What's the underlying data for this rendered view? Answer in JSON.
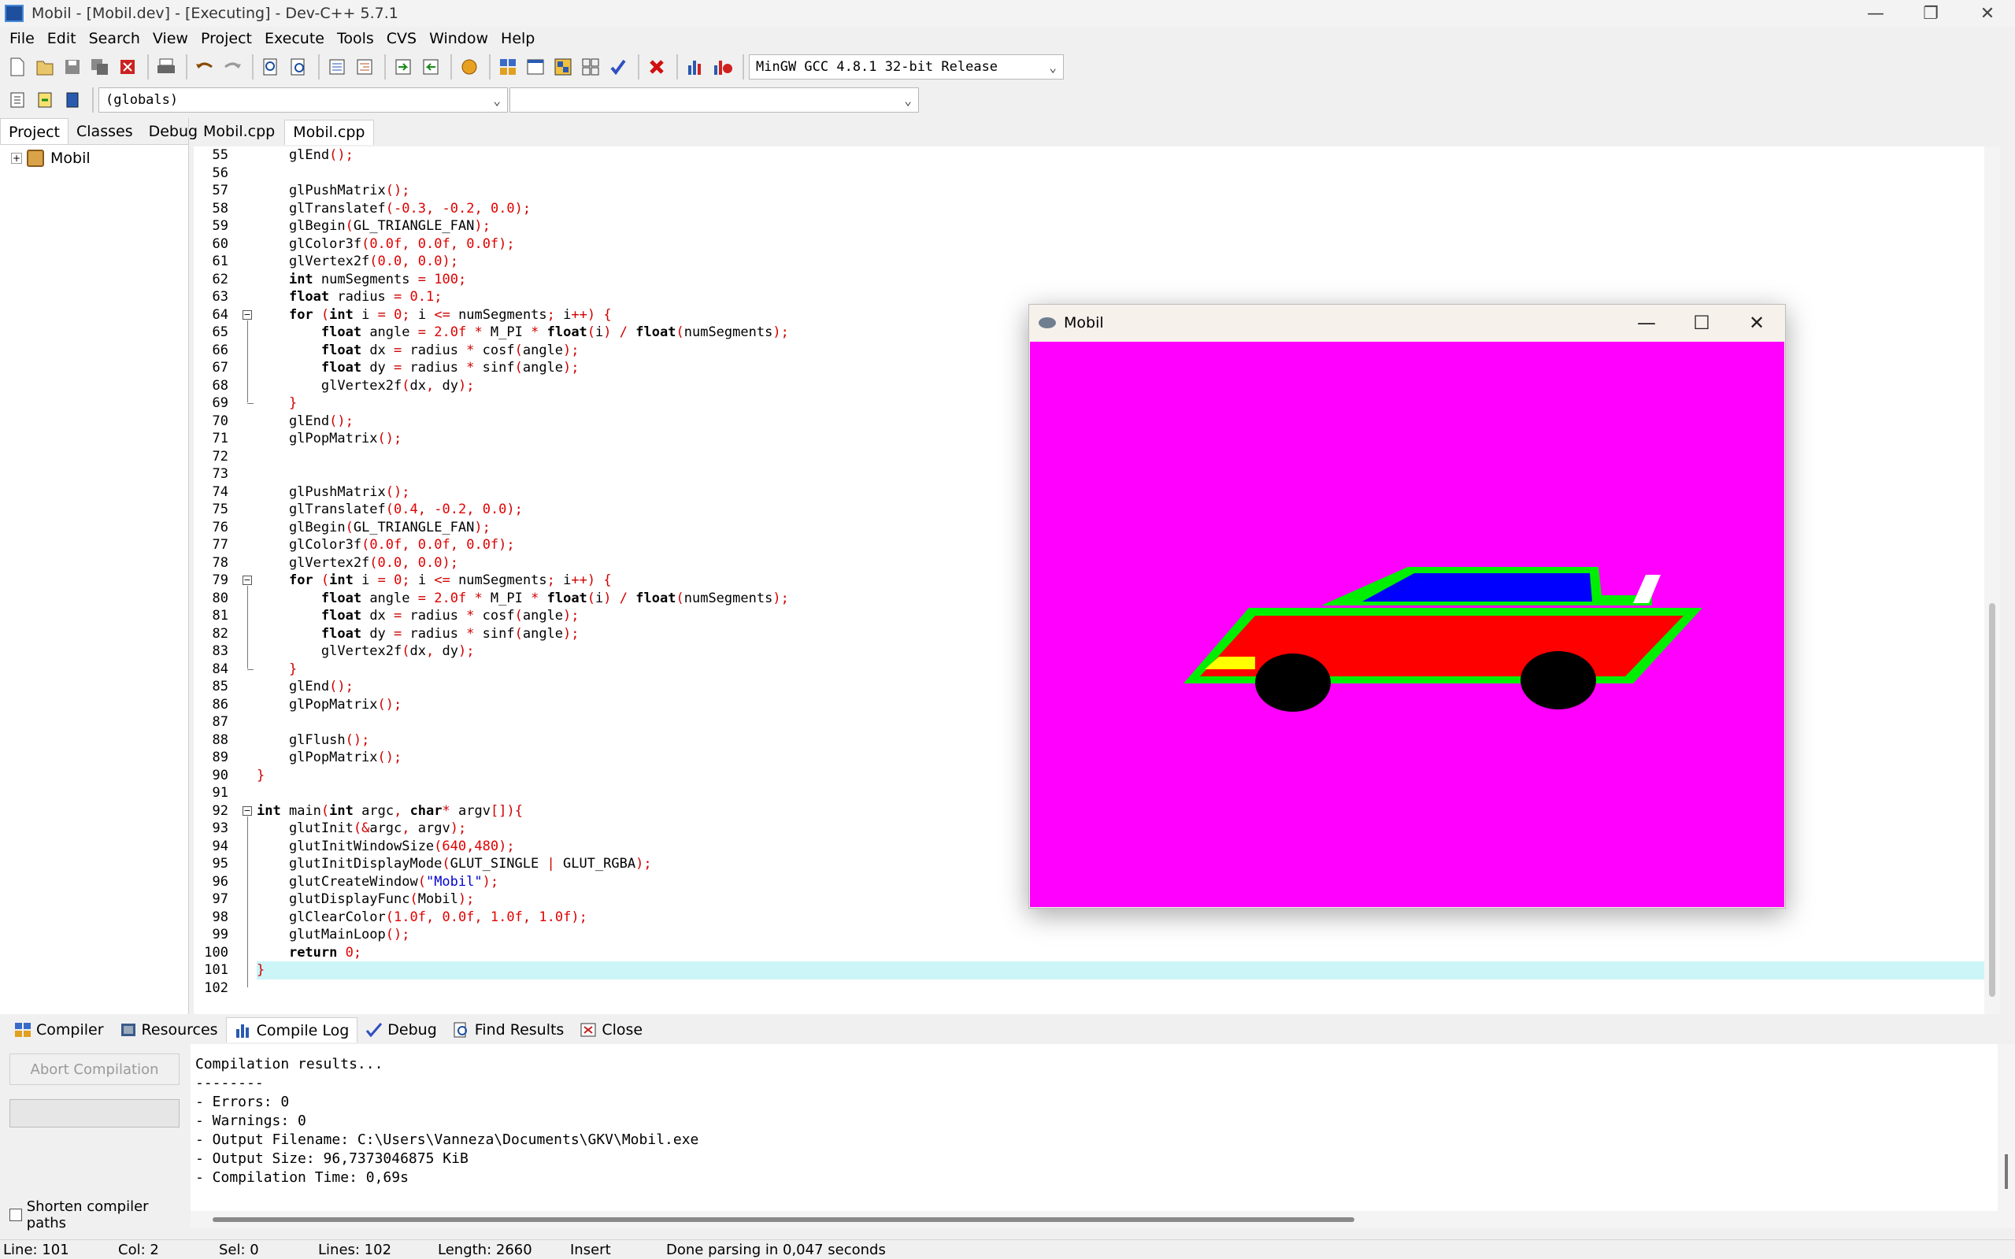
{
  "window": {
    "title": "Mobil - [Mobil.dev] - [Executing] - Dev-C++ 5.7.1",
    "minimize": "—",
    "maximize": "❐",
    "close": "✕"
  },
  "menu": [
    "File",
    "Edit",
    "Search",
    "View",
    "Project",
    "Execute",
    "Tools",
    "CVS",
    "Window",
    "Help"
  ],
  "toolbar": {
    "compiler_select": "MinGW GCC 4.8.1 32-bit Release",
    "scope_select": "(globals)",
    "member_select": ""
  },
  "left_tabs": [
    "Project",
    "Classes",
    "Debug"
  ],
  "project_tree": {
    "root": "Mobil",
    "expander": "+"
  },
  "editor_tabs": [
    "Mobil.cpp",
    "Mobil.cpp"
  ],
  "code": [
    {
      "n": "55",
      "t": "    glEnd();"
    },
    {
      "n": "56",
      "t": ""
    },
    {
      "n": "57",
      "t": "    glPushMatrix();"
    },
    {
      "n": "58",
      "t": "    glTranslatef(-0.3, -0.2, 0.0);"
    },
    {
      "n": "59",
      "t": "    glBegin(GL_TRIANGLE_FAN);"
    },
    {
      "n": "60",
      "t": "    glColor3f(0.0f, 0.0f, 0.0f);"
    },
    {
      "n": "61",
      "t": "    glVertex2f(0.0, 0.0);"
    },
    {
      "n": "62",
      "t": "    int numSegments = 100;"
    },
    {
      "n": "63",
      "t": "    float radius = 0.1;"
    },
    {
      "n": "64",
      "t": "    for (int i = 0; i <= numSegments; i++) {"
    },
    {
      "n": "65",
      "t": "        float angle = 2.0f * M_PI * float(i) / float(numSegments);"
    },
    {
      "n": "66",
      "t": "        float dx = radius * cosf(angle);"
    },
    {
      "n": "67",
      "t": "        float dy = radius * sinf(angle);"
    },
    {
      "n": "68",
      "t": "        glVertex2f(dx, dy);"
    },
    {
      "n": "69",
      "t": "    }"
    },
    {
      "n": "70",
      "t": "    glEnd();"
    },
    {
      "n": "71",
      "t": "    glPopMatrix();"
    },
    {
      "n": "72",
      "t": ""
    },
    {
      "n": "73",
      "t": ""
    },
    {
      "n": "74",
      "t": "    glPushMatrix();"
    },
    {
      "n": "75",
      "t": "    glTranslatef(0.4, -0.2, 0.0);"
    },
    {
      "n": "76",
      "t": "    glBegin(GL_TRIANGLE_FAN);"
    },
    {
      "n": "77",
      "t": "    glColor3f(0.0f, 0.0f, 0.0f);"
    },
    {
      "n": "78",
      "t": "    glVertex2f(0.0, 0.0);"
    },
    {
      "n": "79",
      "t": "    for (int i = 0; i <= numSegments; i++) {"
    },
    {
      "n": "80",
      "t": "        float angle = 2.0f * M_PI * float(i) / float(numSegments);"
    },
    {
      "n": "81",
      "t": "        float dx = radius * cosf(angle);"
    },
    {
      "n": "82",
      "t": "        float dy = radius * sinf(angle);"
    },
    {
      "n": "83",
      "t": "        glVertex2f(dx, dy);"
    },
    {
      "n": "84",
      "t": "    }"
    },
    {
      "n": "85",
      "t": "    glEnd();"
    },
    {
      "n": "86",
      "t": "    glPopMatrix();"
    },
    {
      "n": "87",
      "t": ""
    },
    {
      "n": "88",
      "t": "    glFlush();"
    },
    {
      "n": "89",
      "t": "    glPopMatrix();"
    },
    {
      "n": "90",
      "t": "}"
    },
    {
      "n": "91",
      "t": ""
    },
    {
      "n": "92",
      "t": "int main(int argc, char* argv[]){"
    },
    {
      "n": "93",
      "t": "    glutInit(&argc, argv);"
    },
    {
      "n": "94",
      "t": "    glutInitWindowSize(640,480);"
    },
    {
      "n": "95",
      "t": "    glutInitDisplayMode(GLUT_SINGLE | GLUT_RGBA);"
    },
    {
      "n": "96",
      "t": "    glutCreateWindow(\"Mobil\");"
    },
    {
      "n": "97",
      "t": "    glutDisplayFunc(Mobil);"
    },
    {
      "n": "98",
      "t": "    glClearColor(1.0f, 0.0f, 1.0f, 1.0f);"
    },
    {
      "n": "99",
      "t": "    glutMainLoop();"
    },
    {
      "n": "100",
      "t": "    return 0;"
    },
    {
      "n": "101",
      "t": "}"
    },
    {
      "n": "102",
      "t": ""
    }
  ],
  "bottom_tabs": [
    "Compiler",
    "Resources",
    "Compile Log",
    "Debug",
    "Find Results",
    "Close"
  ],
  "compile": {
    "abort_label": "Abort Compilation",
    "shorten_label": "Shorten compiler paths",
    "log": [
      "Compilation results...",
      "--------",
      "- Errors: 0",
      "- Warnings: 0",
      "- Output Filename: C:\\Users\\Vanneza\\Documents\\GKV\\Mobil.exe",
      "- Output Size: 96,7373046875 KiB",
      "- Compilation Time: 0,69s"
    ]
  },
  "status": {
    "line": "Line:   101",
    "col": "Col:    2",
    "sel": "Sel:    0",
    "lines": "Lines:   102",
    "length": "Length:  2660",
    "mode": "Insert",
    "message": "Done parsing in 0,047 seconds"
  },
  "gl_window": {
    "title": "Mobil",
    "minimize": "—",
    "maximize": "☐",
    "close": "✕",
    "background": "#ff00ff"
  },
  "colors": {
    "keyword": "#000000",
    "number": "#e00000",
    "string": "#0000d0",
    "current_line": "#ccf5f7",
    "car_body": "#ff0000",
    "car_outline": "#00ee00",
    "car_window": "#0000ff",
    "wheel": "#000000",
    "headlight": "#ffff00"
  }
}
